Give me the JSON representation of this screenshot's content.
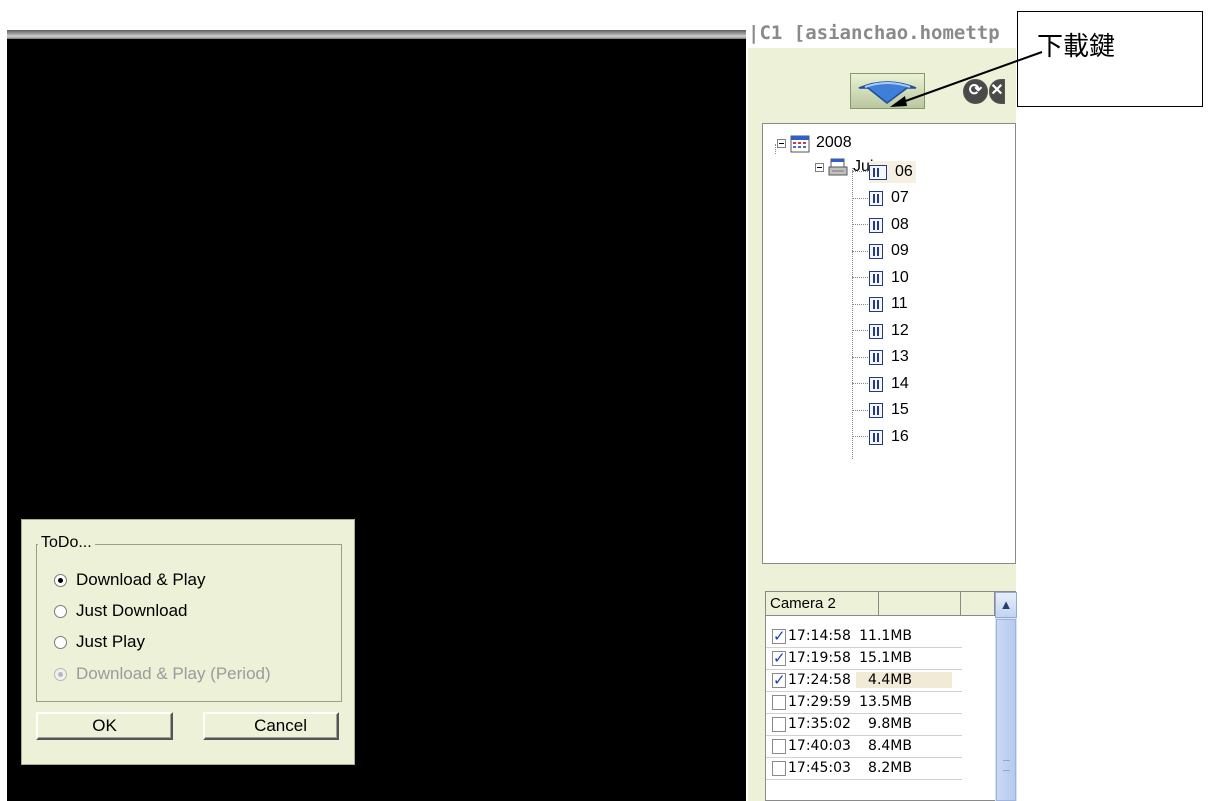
{
  "right_panel": {
    "title": "|C1 [asianchao.homettp",
    "tool_icons": [
      "download-icon",
      "refresh-icon",
      "close-icon"
    ]
  },
  "annotation": {
    "callout_text": "下載鍵"
  },
  "tree": {
    "year": "2008",
    "month": "Jul",
    "days": [
      "06",
      "07",
      "08",
      "09",
      "10",
      "11",
      "12",
      "13",
      "14",
      "15",
      "16"
    ],
    "selected_day": "06"
  },
  "recordings": {
    "headers": [
      "Camera 2",
      "",
      ""
    ],
    "rows": [
      {
        "time": "17:14:58",
        "size": "11.1MB",
        "checked": true
      },
      {
        "time": "17:19:58",
        "size": "15.1MB",
        "checked": true
      },
      {
        "time": "17:24:58",
        "size": "4.4MB",
        "checked": true
      },
      {
        "time": "17:29:59",
        "size": "13.5MB",
        "checked": false
      },
      {
        "time": "17:35:02",
        "size": "9.8MB",
        "checked": false
      },
      {
        "time": "17:40:03",
        "size": "8.4MB",
        "checked": false
      },
      {
        "time": "17:45:03",
        "size": "8.2MB",
        "checked": false
      }
    ]
  },
  "todo_dialog": {
    "group_label": "ToDo...",
    "options": [
      {
        "label": "Download & Play",
        "selected": true,
        "enabled": true
      },
      {
        "label": "Just Download",
        "selected": false,
        "enabled": true
      },
      {
        "label": "Just Play",
        "selected": false,
        "enabled": true
      },
      {
        "label": "Download & Play (Period)",
        "selected": false,
        "enabled": false
      }
    ],
    "ok_label": "OK",
    "cancel_label": "Cancel"
  }
}
